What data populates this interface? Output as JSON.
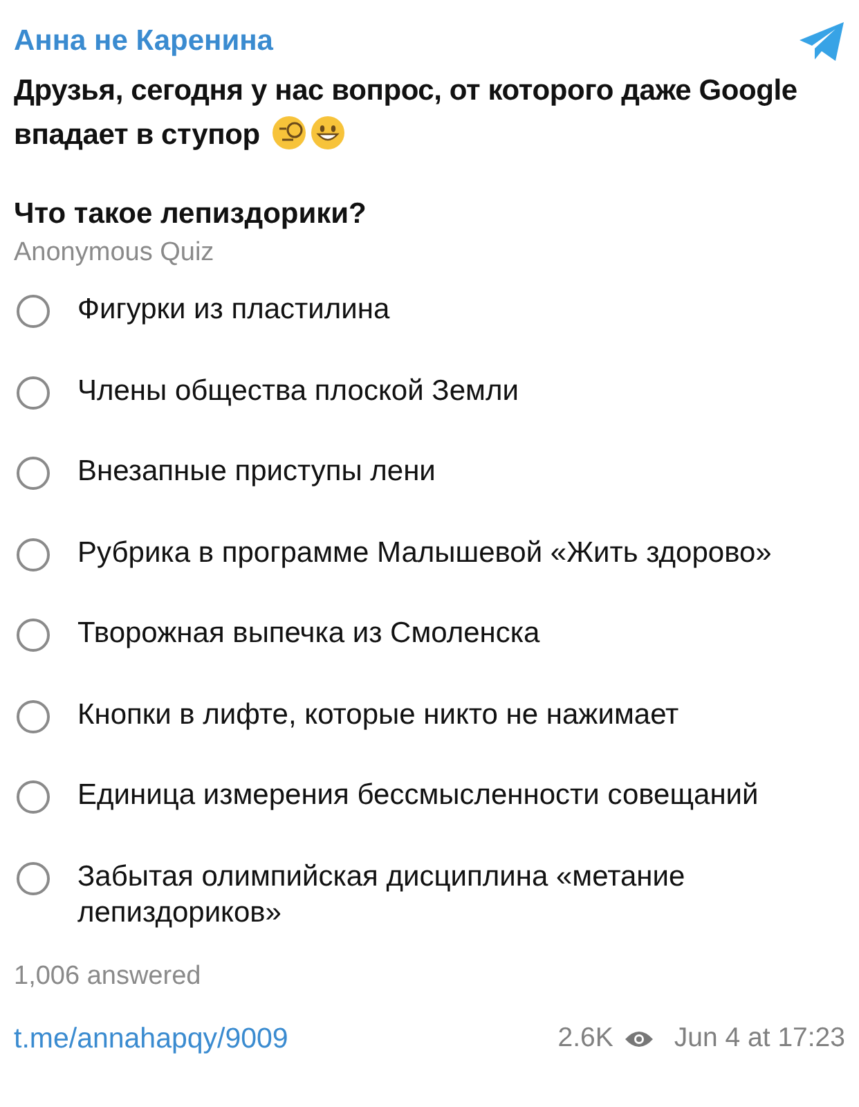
{
  "channel": {
    "name": "Анна не Каренина"
  },
  "message": {
    "lines": [
      "Друзья, сегодня у нас вопрос, от которого даже Google",
      "впадает в ступор"
    ]
  },
  "quiz": {
    "question": "Что такое лепиздорики?",
    "type": "Anonymous Quiz",
    "options": [
      {
        "label": "Фигурки из пластилина",
        "selected": false
      },
      {
        "label": "Члены общества плоской Земли",
        "selected": false
      },
      {
        "label": "Внезапные приступы лени",
        "selected": false
      },
      {
        "label": "Рубрика в программе Малышевой «Жить здорово»",
        "selected": false
      },
      {
        "label": "Творожная выпечка из Смоленска",
        "selected": false
      },
      {
        "label": "Кнопки в лифте, которые никто не нажимает",
        "selected": false
      },
      {
        "label": "Единица измерения бессмысленности совещаний",
        "selected": false
      },
      {
        "label": "Забытая олимпийская дисциплина «метание лепиздориков»",
        "selected": false
      }
    ],
    "answered": "1,006 answered"
  },
  "footer": {
    "link": "t.me/annahapqy/9009",
    "views": "2.6K",
    "date": "Jun 4 at 17:23"
  }
}
